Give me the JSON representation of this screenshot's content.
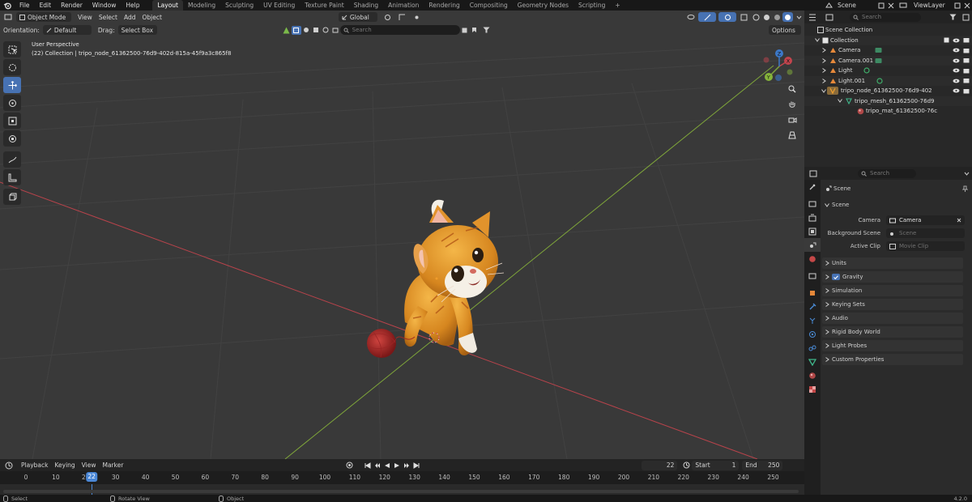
{
  "topbar": {
    "menus": [
      "File",
      "Edit",
      "Render",
      "Window",
      "Help"
    ],
    "workspaces": [
      "Layout",
      "Modeling",
      "Sculpting",
      "UV Editing",
      "Texture Paint",
      "Shading",
      "Animation",
      "Rendering",
      "Compositing",
      "Geometry Nodes",
      "Scripting"
    ],
    "active_workspace": "Layout",
    "add_tab_symbol": "+",
    "scene": "Scene",
    "view_layer": "ViewLayer"
  },
  "viewport": {
    "mode": "Object Mode",
    "menus": [
      "View",
      "Select",
      "Add",
      "Object"
    ],
    "transform_orientation": "Global",
    "search_placeholder": "Search",
    "options_label": "Options",
    "orientation_label": "Orientation:",
    "orientation_value": "Default",
    "drag_label": "Drag:",
    "drag_value": "Select Box",
    "overlay_title": "User Perspective",
    "overlay_subtitle": "(22) Collection | tripo_node_61362500-76d9-402d-815a-45f9a3c865f8",
    "gizmo_axes": [
      "X",
      "Y",
      "Z"
    ],
    "colors": {
      "x_axis": "#c2444d",
      "y_axis": "#86b43b",
      "z_axis": "#3c78c8",
      "active_tool": "#4772b3"
    }
  },
  "timeline": {
    "menus": [
      "Playback",
      "Keying",
      "View",
      "Marker"
    ],
    "current_frame": "22",
    "start_label": "Start",
    "start": "1",
    "end_label": "End",
    "end": "250",
    "ticks": [
      "0",
      "10",
      "20",
      "30",
      "40",
      "50",
      "60",
      "70",
      "80",
      "90",
      "100",
      "110",
      "120",
      "130",
      "140",
      "150",
      "160",
      "170",
      "180",
      "190",
      "200",
      "210",
      "220",
      "230",
      "240",
      "250"
    ]
  },
  "statusbar": {
    "select": "Select",
    "rotate": "Rotate View",
    "object": "Object",
    "version": "4.2.0"
  },
  "outliner": {
    "search_placeholder": "Search",
    "items": [
      {
        "label": "Scene Collection",
        "icon": "scene-collection-icon"
      },
      {
        "label": "Collection",
        "icon": "collection-icon"
      },
      {
        "label": "Camera",
        "icon": "camera-icon"
      },
      {
        "label": "Camera.001",
        "icon": "camera-icon"
      },
      {
        "label": "Light",
        "icon": "light-icon"
      },
      {
        "label": "Light.001",
        "icon": "light-icon"
      },
      {
        "label": "tripo_node_61362500-76d9-402",
        "icon": "mesh-object-icon"
      },
      {
        "label": "tripo_mesh_61362500-76d9",
        "icon": "mesh-data-icon"
      },
      {
        "label": "tripo_mat_61362500-76c",
        "icon": "material-icon"
      }
    ]
  },
  "properties": {
    "search_placeholder": "Search",
    "context": "Scene",
    "panel_scene": "Scene",
    "camera_label": "Camera",
    "camera_value": "Camera",
    "background_scene_label": "Background Scene",
    "background_scene_placeholder": "Scene",
    "active_clip_label": "Active Clip",
    "active_clip_placeholder": "Movie Clip",
    "panels": [
      "Units",
      "Gravity",
      "Simulation",
      "Keying Sets",
      "Audio",
      "Rigid Body World",
      "Light Probes",
      "Custom Properties"
    ],
    "gravity_checked": true
  }
}
